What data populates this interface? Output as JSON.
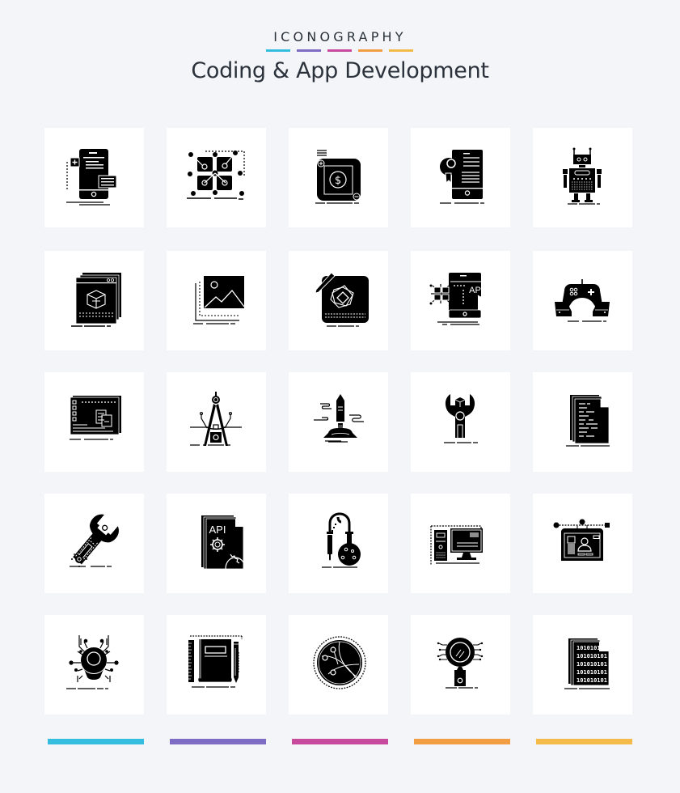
{
  "header": {
    "brand": "ICONOGRAPHY",
    "title": "Coding & App Development"
  },
  "palette": [
    "#35bde0",
    "#7d6bc4",
    "#c84a9c",
    "#f29d43",
    "#f4bb4b"
  ],
  "icons": [
    {
      "name": "mobile-app-add-icon"
    },
    {
      "name": "node-grid-design-icon"
    },
    {
      "name": "app-payment-icon"
    },
    {
      "name": "mobile-certificate-icon"
    },
    {
      "name": "robot-icon"
    },
    {
      "name": "web-3d-box-icon"
    },
    {
      "name": "image-gallery-icon"
    },
    {
      "name": "app-design-pencil-icon"
    },
    {
      "name": "mobile-api-icon"
    },
    {
      "name": "game-controller-hands-icon"
    },
    {
      "name": "window-layout-icon"
    },
    {
      "name": "compass-drafting-icon"
    },
    {
      "name": "rocket-launch-icon"
    },
    {
      "name": "wrench-box-icon"
    },
    {
      "name": "code-document-icon"
    },
    {
      "name": "wrench-gear-icon"
    },
    {
      "name": "api-document-gear-icon"
    },
    {
      "name": "chemistry-flask-icon"
    },
    {
      "name": "desktop-computer-icon"
    },
    {
      "name": "profile-screen-design-icon"
    },
    {
      "name": "bug-icon"
    },
    {
      "name": "notebook-ruler-pencil-icon"
    },
    {
      "name": "network-globe-icon"
    },
    {
      "name": "magnifier-circuit-icon"
    },
    {
      "name": "binary-document-icon"
    }
  ],
  "icon_text": {
    "api_label": "API",
    "binary_short": "1010101",
    "binary_row": "101010101"
  }
}
